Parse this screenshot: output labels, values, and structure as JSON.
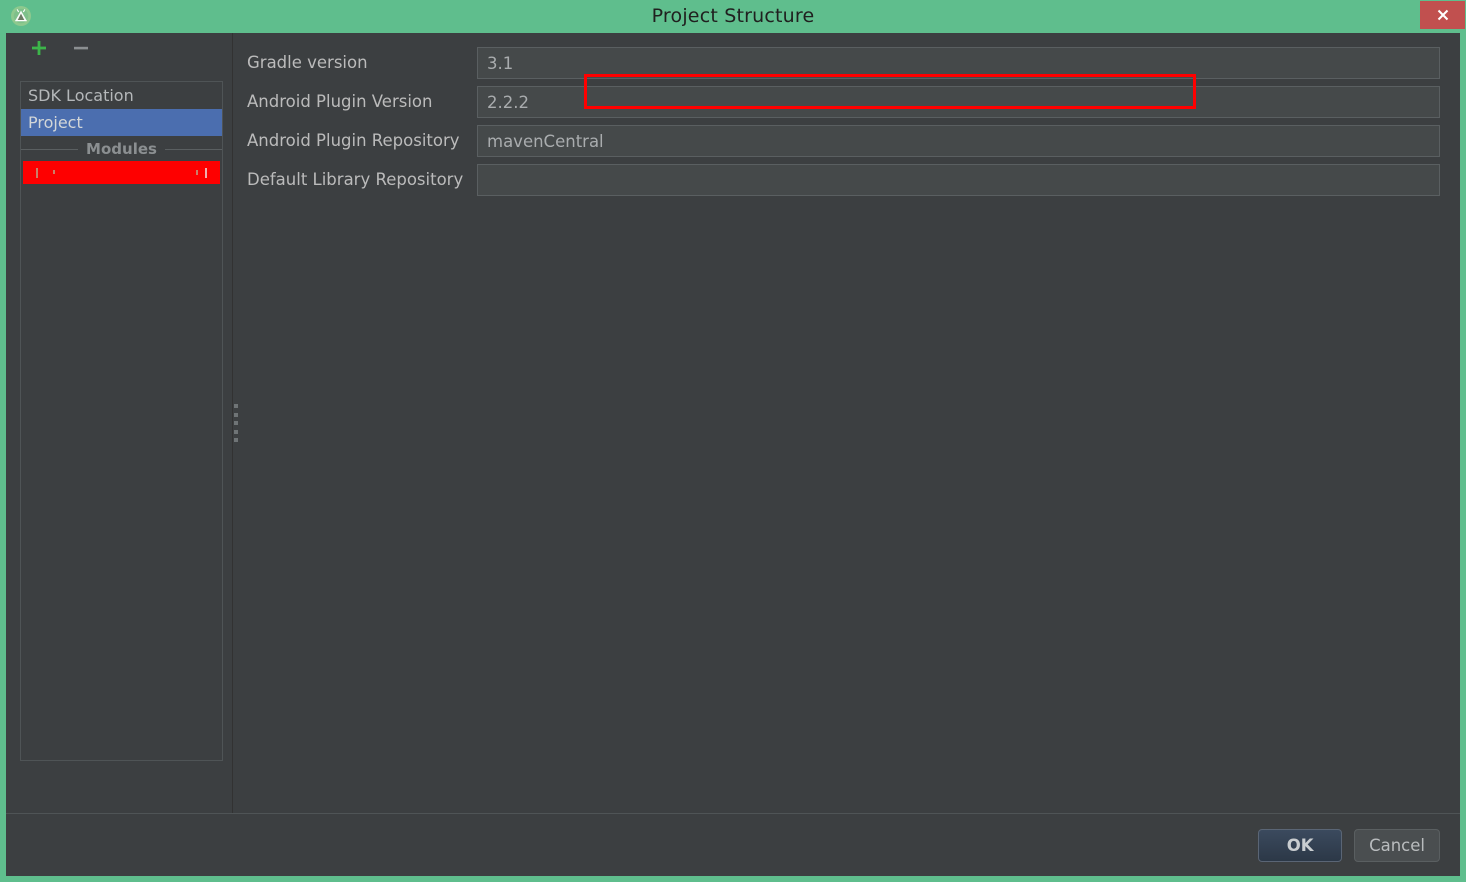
{
  "window": {
    "title": "Project Structure",
    "app_icon": "android-studio-icon",
    "close_icon": "close-icon",
    "titlebar_color": "#5fbe8d",
    "close_button_color": "#c1504f",
    "panel_color": "#3c3f41"
  },
  "sidebar": {
    "toolbar": {
      "add_icon": "plus-icon",
      "add_color": "#3cb54a",
      "remove_icon": "minus-icon",
      "remove_color": "#8b8f91"
    },
    "items": [
      {
        "label": "SDK Location",
        "selected": false
      },
      {
        "label": "Project",
        "selected": true
      }
    ],
    "section_label": "Modules",
    "module_items": [
      {
        "label": "",
        "redacted": true,
        "redaction_color": "#fe0000"
      }
    ],
    "selection_color": "#4b6eaf"
  },
  "splitter": {
    "name": "panel-splitter",
    "grip_dots": 5
  },
  "form": {
    "rows": [
      {
        "label": "Gradle version",
        "value": "3.1",
        "placeholder": "",
        "highlighted": true
      },
      {
        "label": "Android Plugin Version",
        "value": "2.2.2",
        "placeholder": "",
        "highlighted": false
      },
      {
        "label": "Android Plugin Repository",
        "value": "mavenCentral",
        "placeholder": "",
        "highlighted": false
      },
      {
        "label": "Default Library Repository",
        "value": "",
        "placeholder": "",
        "highlighted": false
      }
    ],
    "annotation": {
      "name": "gradle-version-highlight",
      "color": "#ff0000"
    }
  },
  "footer": {
    "ok_label": "OK",
    "cancel_label": "Cancel",
    "ok_accent": "#3b4a5e"
  }
}
